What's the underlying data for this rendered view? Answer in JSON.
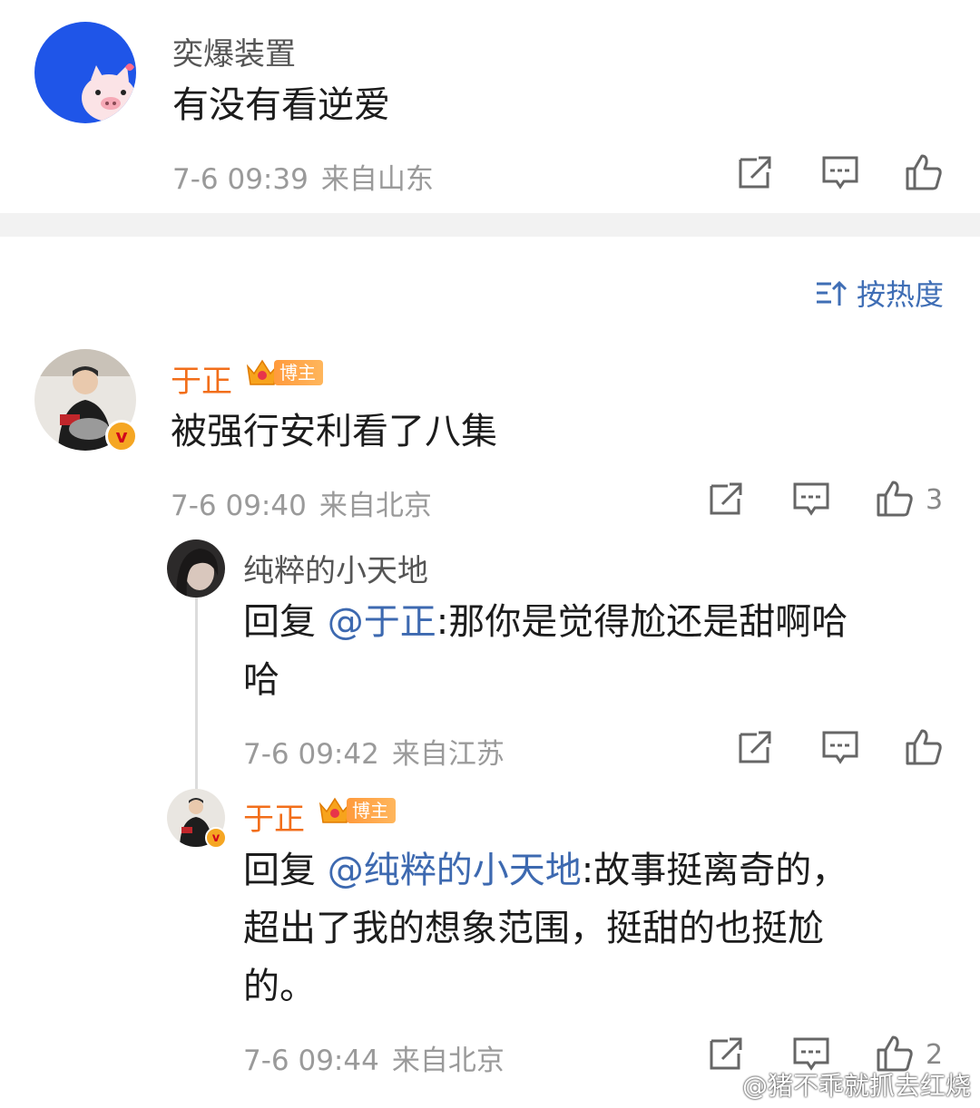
{
  "comments": [
    {
      "name": "奕爆装置",
      "text": "有没有看逆爱",
      "time": "7-6 09:39",
      "location": "来自山东",
      "likes": ""
    },
    {
      "name": "于正",
      "badge": "博主",
      "text": "被强行安利看了八集",
      "time": "7-6 09:40",
      "location": "来自北京",
      "likes": "3"
    }
  ],
  "sort": {
    "label": "按热度"
  },
  "replies": [
    {
      "name": "纯粹的小天地",
      "reply_prefix": "回复 ",
      "mention": "@于正",
      "text_line1": ":那你是觉得尬还是甜啊哈",
      "text_line2": "哈",
      "time": "7-6 09:42",
      "location": "来自江苏",
      "likes": ""
    },
    {
      "name": "于正",
      "badge": "博主",
      "reply_prefix": "回复 ",
      "mention": "@纯粹的小天地",
      "text_line1": ":故事挺离奇的，",
      "text_line2": "超出了我的想象范围，挺甜的也挺尬",
      "text_line3": "的。",
      "time": "7-6 09:44",
      "location": "来自北京",
      "likes": "2"
    }
  ],
  "watermark": "@猪不乖就抓去红烧",
  "icons": [
    "share-icon",
    "comment-icon",
    "like-icon",
    "sort-icon",
    "crown-icon",
    "verified-icon",
    "weibo-logo-icon"
  ],
  "colors": {
    "accent": "#3f6eb5",
    "vip_name": "#f26e1a",
    "meta": "#9a9a9a",
    "divider": "#f2f2f2"
  }
}
